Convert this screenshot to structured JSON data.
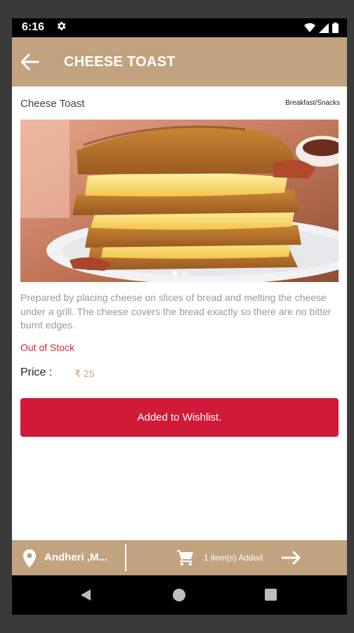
{
  "status_bar": {
    "time": "6:16"
  },
  "app_bar": {
    "title": "CHEESE TOAST"
  },
  "product": {
    "name": "Cheese Toast",
    "category": "Breakfast/Snacks",
    "description": "Prepared by placing cheese on slices of bread and melting the cheese under a grill. The cheese covers the bread exactly so there are no bitter burnt edges.",
    "stock_status": "Out of Stock",
    "price_label": "Price :",
    "price_value": "₹ 25"
  },
  "actions": {
    "wishlist_label": "Added to Wishlist."
  },
  "bottom_bar": {
    "location": "Andheri ,M...",
    "cart_status": "1 item(s) Added"
  },
  "colors": {
    "accent": "#c2a37f",
    "button": "#d11a39",
    "stock": "#d6243f",
    "price": "#d4a571"
  },
  "carousel": {
    "slide_count": 2,
    "active_index": 0
  }
}
